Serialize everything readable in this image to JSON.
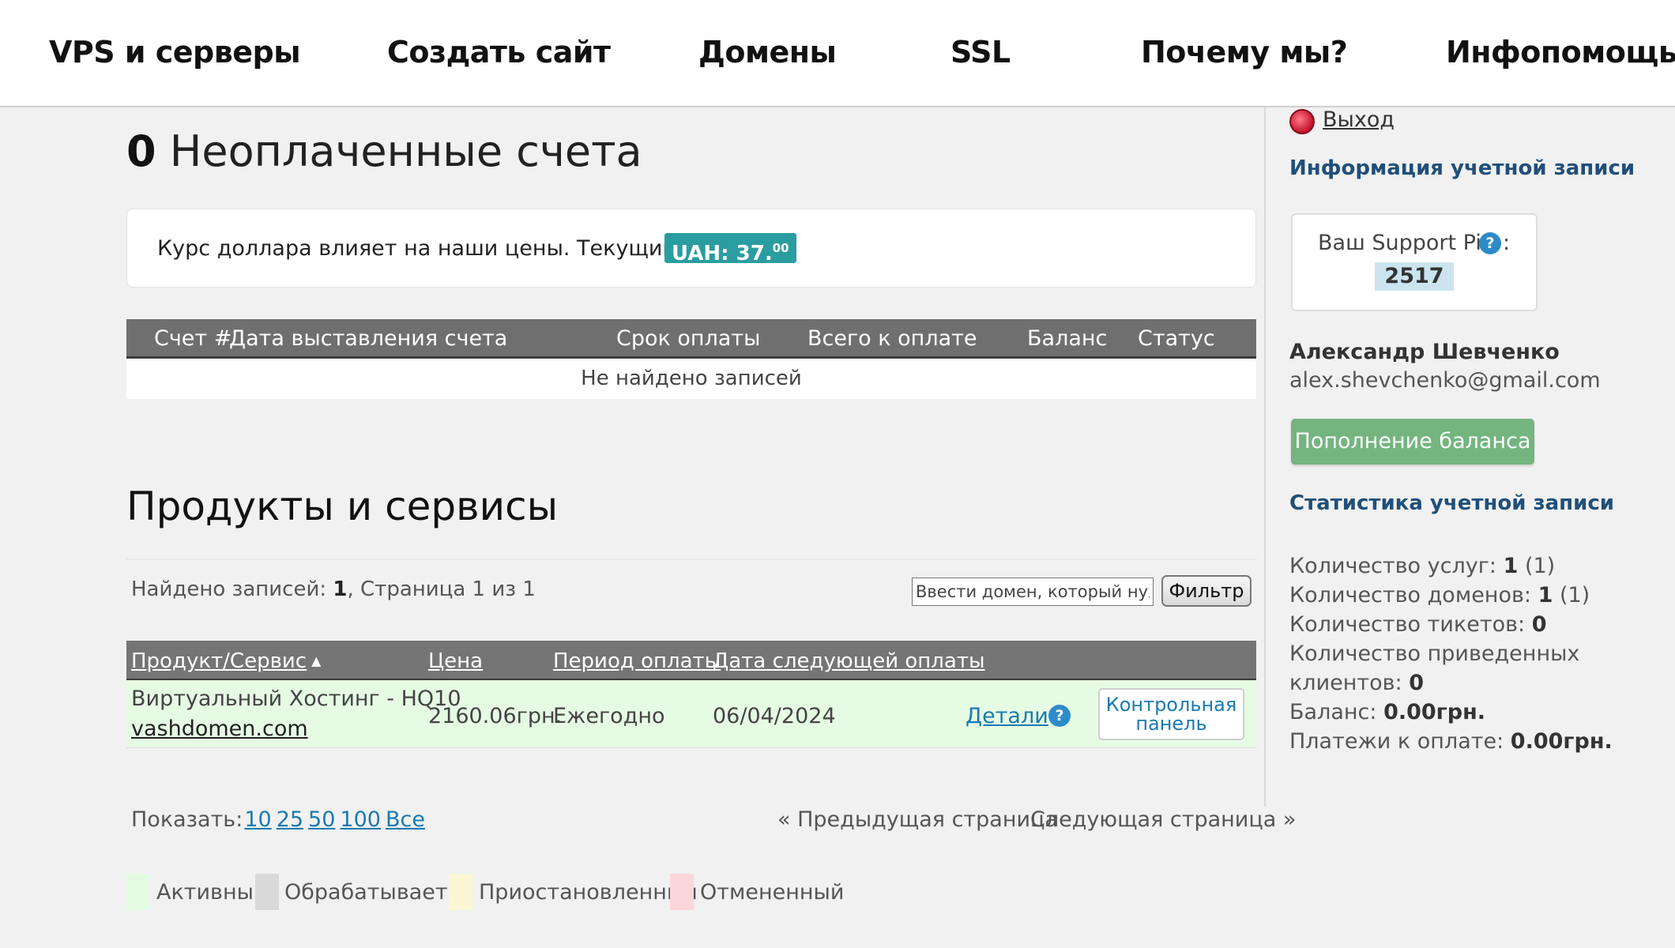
{
  "nav": {
    "items": [
      "VPS и серверы",
      "Создать сайт",
      "Домены",
      "SSL",
      "Почему мы?",
      "Инфопомощь"
    ]
  },
  "invoices": {
    "count": "0",
    "title": "Неоплаченные счета",
    "rate_text": "Курс доллара влияет на наши цены. Текущий курс:",
    "rate_badge": "UAH: 37.",
    "rate_badge_cents": "00",
    "columns": [
      "Счет #",
      "Дата выставления счета",
      "Срок оплаты",
      "Всего к оплате",
      "Баланс",
      "Статус"
    ],
    "empty_text": "Не найдено записей"
  },
  "products": {
    "title": "Продукты и сервисы",
    "found_label": "Найдено записей: ",
    "found_count": "1",
    "page_text": ", Страница 1 из 1",
    "filter_placeholder": "Ввести домен, который нужно найти",
    "filter_button": "Фильтр",
    "columns": [
      "Продукт/Сервис",
      "Цена",
      "Период оплаты",
      "Дата следующей оплаты"
    ],
    "sort_indicator": "▲",
    "rows": [
      {
        "product": "Виртуальный Хостинг - HQ10",
        "domain": "vashdomen.com",
        "price": "2160.06грн.",
        "period": "Ежегодно",
        "next_date": "06/04/2024",
        "details": "Детали",
        "help": "?",
        "control_panel_line1": "Контрольная",
        "control_panel_line2": "панель"
      }
    ],
    "show_label": "Показать:",
    "show_options": [
      "10",
      "25",
      "50",
      "100",
      "Все"
    ],
    "prev_page": "« Предыдущая страница",
    "next_page": "Следующая страница »",
    "legend": [
      {
        "label": "Активный",
        "color": "#e2fbe0"
      },
      {
        "label": "Обрабатывается",
        "color": "#d9d9d9"
      },
      {
        "label": "Приостановленный",
        "color": "#fdf6d4"
      },
      {
        "label": "Отмененный",
        "color": "#fbd7d9"
      }
    ]
  },
  "sidebar": {
    "logout": "Выход",
    "account_info_title": "Информация учетной записи",
    "support_pin_label": "Ваш Support Pin",
    "support_pin_help": "?",
    "support_pin_colon": ":",
    "support_pin": "2517",
    "user_name": "Александр Шевченко",
    "user_email": "alex.shevchenko@gmail.com",
    "topup_button": "Пополнение баланса",
    "stats_title": "Статистика учетной записи",
    "stats": {
      "services_label": "Количество услуг: ",
      "services_value": "1",
      "services_extra": " (1)",
      "domains_label": "Количество доменов: ",
      "domains_value": "1",
      "domains_extra": " (1)",
      "tickets_label": "Количество тикетов: ",
      "tickets_value": "0",
      "referrals_label": "Количество приведенных клиентов: ",
      "referrals_value": "0",
      "balance_label": "Баланс: ",
      "balance_value": "0.00грн.",
      "due_label": "Платежи к оплате: ",
      "due_value": "0.00грн."
    }
  },
  "colors": {
    "accent_teal": "#2a9da0",
    "link_blue": "#1a7ab0",
    "sidebar_title": "#1f4f7a",
    "table_header": "#757575",
    "active_row": "#e6fbe4",
    "topup_green": "#74b57f"
  }
}
